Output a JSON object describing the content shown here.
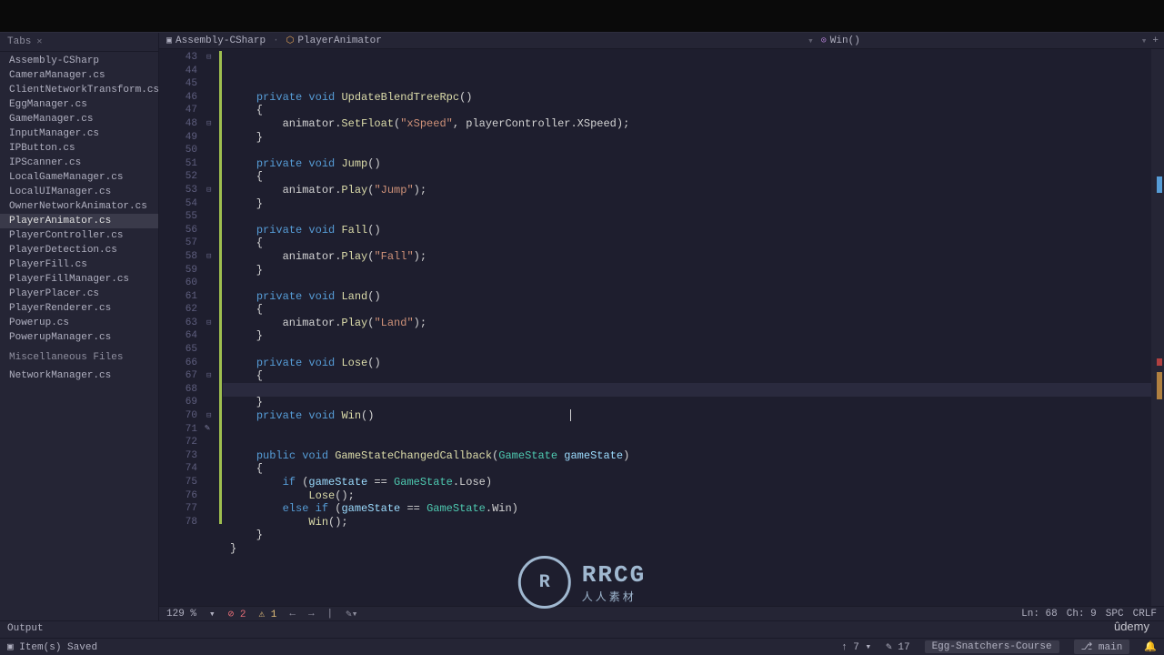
{
  "sidebar": {
    "tabs_label": "Tabs",
    "files": [
      "Assembly-CSharp",
      "CameraManager.cs",
      "ClientNetworkTransform.cs",
      "EggManager.cs",
      "GameManager.cs",
      "InputManager.cs",
      "IPButton.cs",
      "IPScanner.cs",
      "LocalGameManager.cs",
      "LocalUIManager.cs",
      "OwnerNetworkAnimator.cs",
      "PlayerAnimator.cs",
      "PlayerController.cs",
      "PlayerDetection.cs",
      "PlayerFill.cs",
      "PlayerFillManager.cs",
      "PlayerPlacer.cs",
      "PlayerRenderer.cs",
      "Powerup.cs",
      "PowerupManager.cs"
    ],
    "active_index": 11,
    "misc_header": "Miscellaneous Files",
    "misc_files": [
      "NetworkManager.cs"
    ]
  },
  "breadcrumb": {
    "project": "Assembly-CSharp",
    "class": "PlayerAnimator",
    "member": "Win()"
  },
  "lines": {
    "start": 43,
    "end": 78
  },
  "code": {
    "l43": {
      "p1": "private void ",
      "m": "UpdateBlendTreeRpc",
      "p2": "()"
    },
    "l44": "{",
    "l45": {
      "pre": "        animator.",
      "m": "SetFloat",
      "args1": "(",
      "s1": "\"xSpeed\"",
      "args2": ", playerController.XSpeed);"
    },
    "l46": "}",
    "l48": {
      "p1": "private void ",
      "m": "Jump",
      "p2": "()"
    },
    "l49": "{",
    "l50": {
      "pre": "        animator.",
      "m": "Play",
      "a": "(",
      "s": "\"Jump\"",
      "b": ");"
    },
    "l51": "}",
    "l53": {
      "p1": "private void ",
      "m": "Fall",
      "p2": "()"
    },
    "l54": "{",
    "l55": {
      "pre": "        animator.",
      "m": "Play",
      "a": "(",
      "s": "\"Fall\"",
      "b": ");"
    },
    "l56": "}",
    "l58": {
      "p1": "private void ",
      "m": "Land",
      "p2": "()"
    },
    "l59": "{",
    "l60": {
      "pre": "        animator.",
      "m": "Play",
      "a": "(",
      "s": "\"Land\"",
      "b": ");"
    },
    "l61": "}",
    "l63": {
      "p1": "private void ",
      "m": "Lose",
      "p2": "()"
    },
    "l64": "{",
    "l66": "}",
    "l67": {
      "p1": "private void ",
      "m": "Win",
      "p2": "()"
    },
    "l70": {
      "p1": "public void ",
      "m": "GameStateChangedCallback",
      "a": "(",
      "t": "GameState",
      "sp": " ",
      "par": "gameState",
      "b": ")"
    },
    "l71": "{",
    "l72": {
      "a": "        ",
      "kw": "if",
      "b": " (",
      "par": "gameState",
      "c": " == ",
      "t": "GameState",
      "d": ".Lose)"
    },
    "l73": {
      "a": "            ",
      "m": "Lose",
      "b": "();"
    },
    "l74": {
      "a": "        ",
      "kw": "else if",
      "b": " (",
      "par": "gameState",
      "c": " == ",
      "t": "GameState",
      "d": ".Win)"
    },
    "l75": {
      "a": "            ",
      "m": "Win",
      "b": "();"
    },
    "l76": "}",
    "l77": "}"
  },
  "editor_status": {
    "zoom": "129 %",
    "errors": "2",
    "warnings": "1"
  },
  "output": "Output",
  "status_msg": "Item(s) Saved",
  "status_bar": {
    "up": "7",
    "down": "17",
    "repo": "Egg-Snatchers-Course",
    "branch": "main",
    "line": "Ln: 68",
    "col": "Ch: 9",
    "spc": "SPC",
    "crlf": "CRLF"
  },
  "logo": {
    "main": "RRCG",
    "sub": "人人素材"
  },
  "udemy": "ûdemy"
}
